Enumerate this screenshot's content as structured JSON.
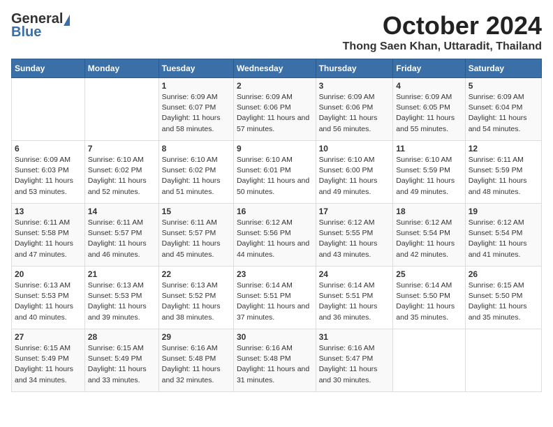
{
  "logo": {
    "general": "General",
    "blue": "Blue"
  },
  "title": {
    "month_year": "October 2024",
    "location": "Thong Saen Khan, Uttaradit, Thailand"
  },
  "weekdays": [
    "Sunday",
    "Monday",
    "Tuesday",
    "Wednesday",
    "Thursday",
    "Friday",
    "Saturday"
  ],
  "weeks": [
    [
      {
        "day": "",
        "sunrise": "",
        "sunset": "",
        "daylight": ""
      },
      {
        "day": "",
        "sunrise": "",
        "sunset": "",
        "daylight": ""
      },
      {
        "day": "1",
        "sunrise": "Sunrise: 6:09 AM",
        "sunset": "Sunset: 6:07 PM",
        "daylight": "Daylight: 11 hours and 58 minutes."
      },
      {
        "day": "2",
        "sunrise": "Sunrise: 6:09 AM",
        "sunset": "Sunset: 6:06 PM",
        "daylight": "Daylight: 11 hours and 57 minutes."
      },
      {
        "day": "3",
        "sunrise": "Sunrise: 6:09 AM",
        "sunset": "Sunset: 6:06 PM",
        "daylight": "Daylight: 11 hours and 56 minutes."
      },
      {
        "day": "4",
        "sunrise": "Sunrise: 6:09 AM",
        "sunset": "Sunset: 6:05 PM",
        "daylight": "Daylight: 11 hours and 55 minutes."
      },
      {
        "day": "5",
        "sunrise": "Sunrise: 6:09 AM",
        "sunset": "Sunset: 6:04 PM",
        "daylight": "Daylight: 11 hours and 54 minutes."
      }
    ],
    [
      {
        "day": "6",
        "sunrise": "Sunrise: 6:09 AM",
        "sunset": "Sunset: 6:03 PM",
        "daylight": "Daylight: 11 hours and 53 minutes."
      },
      {
        "day": "7",
        "sunrise": "Sunrise: 6:10 AM",
        "sunset": "Sunset: 6:02 PM",
        "daylight": "Daylight: 11 hours and 52 minutes."
      },
      {
        "day": "8",
        "sunrise": "Sunrise: 6:10 AM",
        "sunset": "Sunset: 6:02 PM",
        "daylight": "Daylight: 11 hours and 51 minutes."
      },
      {
        "day": "9",
        "sunrise": "Sunrise: 6:10 AM",
        "sunset": "Sunset: 6:01 PM",
        "daylight": "Daylight: 11 hours and 50 minutes."
      },
      {
        "day": "10",
        "sunrise": "Sunrise: 6:10 AM",
        "sunset": "Sunset: 6:00 PM",
        "daylight": "Daylight: 11 hours and 49 minutes."
      },
      {
        "day": "11",
        "sunrise": "Sunrise: 6:10 AM",
        "sunset": "Sunset: 5:59 PM",
        "daylight": "Daylight: 11 hours and 49 minutes."
      },
      {
        "day": "12",
        "sunrise": "Sunrise: 6:11 AM",
        "sunset": "Sunset: 5:59 PM",
        "daylight": "Daylight: 11 hours and 48 minutes."
      }
    ],
    [
      {
        "day": "13",
        "sunrise": "Sunrise: 6:11 AM",
        "sunset": "Sunset: 5:58 PM",
        "daylight": "Daylight: 11 hours and 47 minutes."
      },
      {
        "day": "14",
        "sunrise": "Sunrise: 6:11 AM",
        "sunset": "Sunset: 5:57 PM",
        "daylight": "Daylight: 11 hours and 46 minutes."
      },
      {
        "day": "15",
        "sunrise": "Sunrise: 6:11 AM",
        "sunset": "Sunset: 5:57 PM",
        "daylight": "Daylight: 11 hours and 45 minutes."
      },
      {
        "day": "16",
        "sunrise": "Sunrise: 6:12 AM",
        "sunset": "Sunset: 5:56 PM",
        "daylight": "Daylight: 11 hours and 44 minutes."
      },
      {
        "day": "17",
        "sunrise": "Sunrise: 6:12 AM",
        "sunset": "Sunset: 5:55 PM",
        "daylight": "Daylight: 11 hours and 43 minutes."
      },
      {
        "day": "18",
        "sunrise": "Sunrise: 6:12 AM",
        "sunset": "Sunset: 5:54 PM",
        "daylight": "Daylight: 11 hours and 42 minutes."
      },
      {
        "day": "19",
        "sunrise": "Sunrise: 6:12 AM",
        "sunset": "Sunset: 5:54 PM",
        "daylight": "Daylight: 11 hours and 41 minutes."
      }
    ],
    [
      {
        "day": "20",
        "sunrise": "Sunrise: 6:13 AM",
        "sunset": "Sunset: 5:53 PM",
        "daylight": "Daylight: 11 hours and 40 minutes."
      },
      {
        "day": "21",
        "sunrise": "Sunrise: 6:13 AM",
        "sunset": "Sunset: 5:53 PM",
        "daylight": "Daylight: 11 hours and 39 minutes."
      },
      {
        "day": "22",
        "sunrise": "Sunrise: 6:13 AM",
        "sunset": "Sunset: 5:52 PM",
        "daylight": "Daylight: 11 hours and 38 minutes."
      },
      {
        "day": "23",
        "sunrise": "Sunrise: 6:14 AM",
        "sunset": "Sunset: 5:51 PM",
        "daylight": "Daylight: 11 hours and 37 minutes."
      },
      {
        "day": "24",
        "sunrise": "Sunrise: 6:14 AM",
        "sunset": "Sunset: 5:51 PM",
        "daylight": "Daylight: 11 hours and 36 minutes."
      },
      {
        "day": "25",
        "sunrise": "Sunrise: 6:14 AM",
        "sunset": "Sunset: 5:50 PM",
        "daylight": "Daylight: 11 hours and 35 minutes."
      },
      {
        "day": "26",
        "sunrise": "Sunrise: 6:15 AM",
        "sunset": "Sunset: 5:50 PM",
        "daylight": "Daylight: 11 hours and 35 minutes."
      }
    ],
    [
      {
        "day": "27",
        "sunrise": "Sunrise: 6:15 AM",
        "sunset": "Sunset: 5:49 PM",
        "daylight": "Daylight: 11 hours and 34 minutes."
      },
      {
        "day": "28",
        "sunrise": "Sunrise: 6:15 AM",
        "sunset": "Sunset: 5:49 PM",
        "daylight": "Daylight: 11 hours and 33 minutes."
      },
      {
        "day": "29",
        "sunrise": "Sunrise: 6:16 AM",
        "sunset": "Sunset: 5:48 PM",
        "daylight": "Daylight: 11 hours and 32 minutes."
      },
      {
        "day": "30",
        "sunrise": "Sunrise: 6:16 AM",
        "sunset": "Sunset: 5:48 PM",
        "daylight": "Daylight: 11 hours and 31 minutes."
      },
      {
        "day": "31",
        "sunrise": "Sunrise: 6:16 AM",
        "sunset": "Sunset: 5:47 PM",
        "daylight": "Daylight: 11 hours and 30 minutes."
      },
      {
        "day": "",
        "sunrise": "",
        "sunset": "",
        "daylight": ""
      },
      {
        "day": "",
        "sunrise": "",
        "sunset": "",
        "daylight": ""
      }
    ]
  ]
}
